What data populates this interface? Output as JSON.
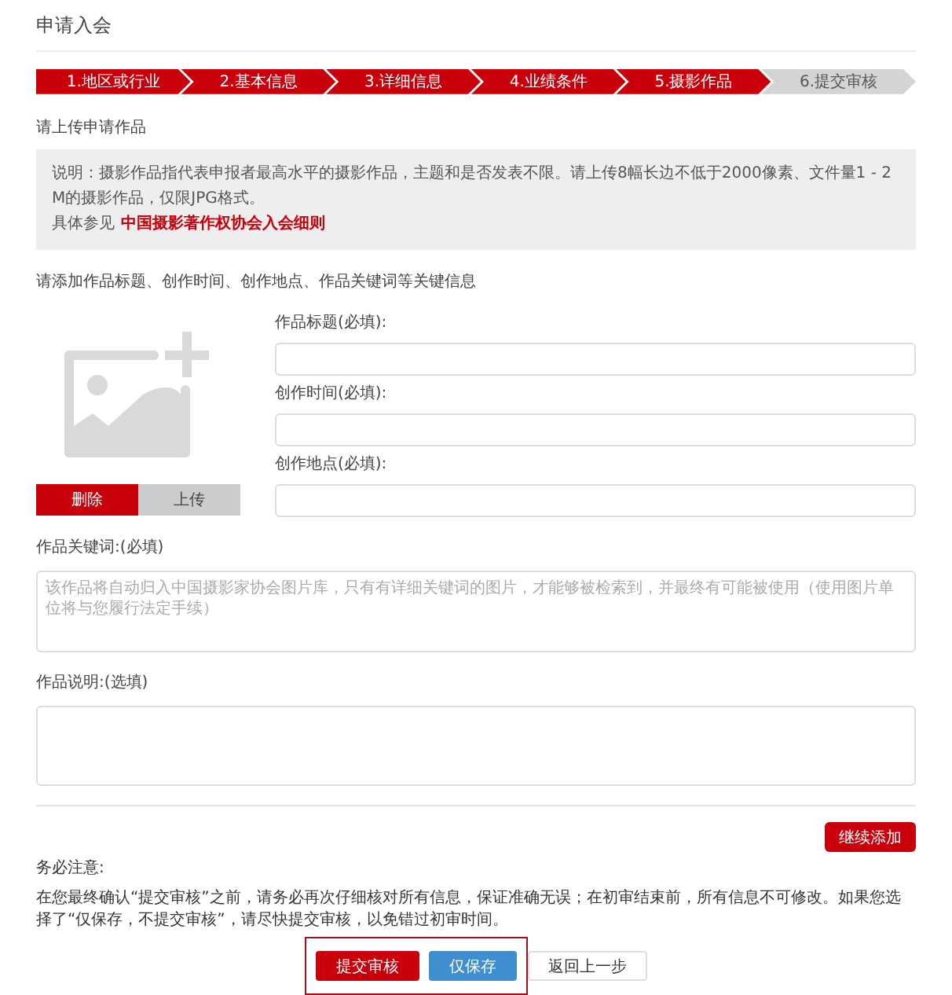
{
  "page_title": "申请入会",
  "steps": [
    {
      "label": "1.地区或行业",
      "done": true
    },
    {
      "label": "2.基本信息",
      "done": true
    },
    {
      "label": "3.详细信息",
      "done": true
    },
    {
      "label": "4.业绩条件",
      "done": true
    },
    {
      "label": "5.摄影作品",
      "done": true
    },
    {
      "label": "6.提交审核",
      "done": false
    }
  ],
  "section_title": "请上传申请作品",
  "notice": {
    "text": "说明：摄影作品指代表申报者最高水平的摄影作品，主题和是否发表不限。请上传8幅长边不低于2000像素、文件量1 - 2 M的摄影作品，仅限JPG格式。",
    "ref_prefix": "具体参见",
    "ref_link": "中国摄影著作权协会入会细则"
  },
  "instruction": "请添加作品标题、创作时间、创作地点、作品关键词等关键信息",
  "image_buttons": [
    {
      "label": "删除",
      "kind": "danger"
    },
    {
      "label": "上传",
      "kind": "neutral"
    }
  ],
  "fields": [
    {
      "label": "作品标题(必填):"
    },
    {
      "label": "创作时间(必填):"
    },
    {
      "label": "创作地点(必填):"
    }
  ],
  "keywords": {
    "label": "作品关键词:(必填)",
    "placeholder": "该作品将自动归入中国摄影家协会图片库，只有有详细关键词的图片，才能够被检索到，并最终有可能被使用（使用图片单位将与您履行法定手续）"
  },
  "description": {
    "label": "作品说明:(选填)"
  },
  "add_more": "继续添加",
  "notes_title": "务必注意:",
  "notes_text": "在您最终确认“提交审核”之前，请务必再次仔细核对所有信息，保证准确无误；在初审结束前，所有信息不可修改。如果您选择了“仅保存，不提交审核”，请尽快提交审核，以免错过初审时间。",
  "actions": [
    {
      "label": "提交审核",
      "kind": "primary",
      "highlighted": true
    },
    {
      "label": "仅保存",
      "kind": "info",
      "highlighted": true
    },
    {
      "label": "返回上一步",
      "kind": "default",
      "highlighted": false
    }
  ]
}
